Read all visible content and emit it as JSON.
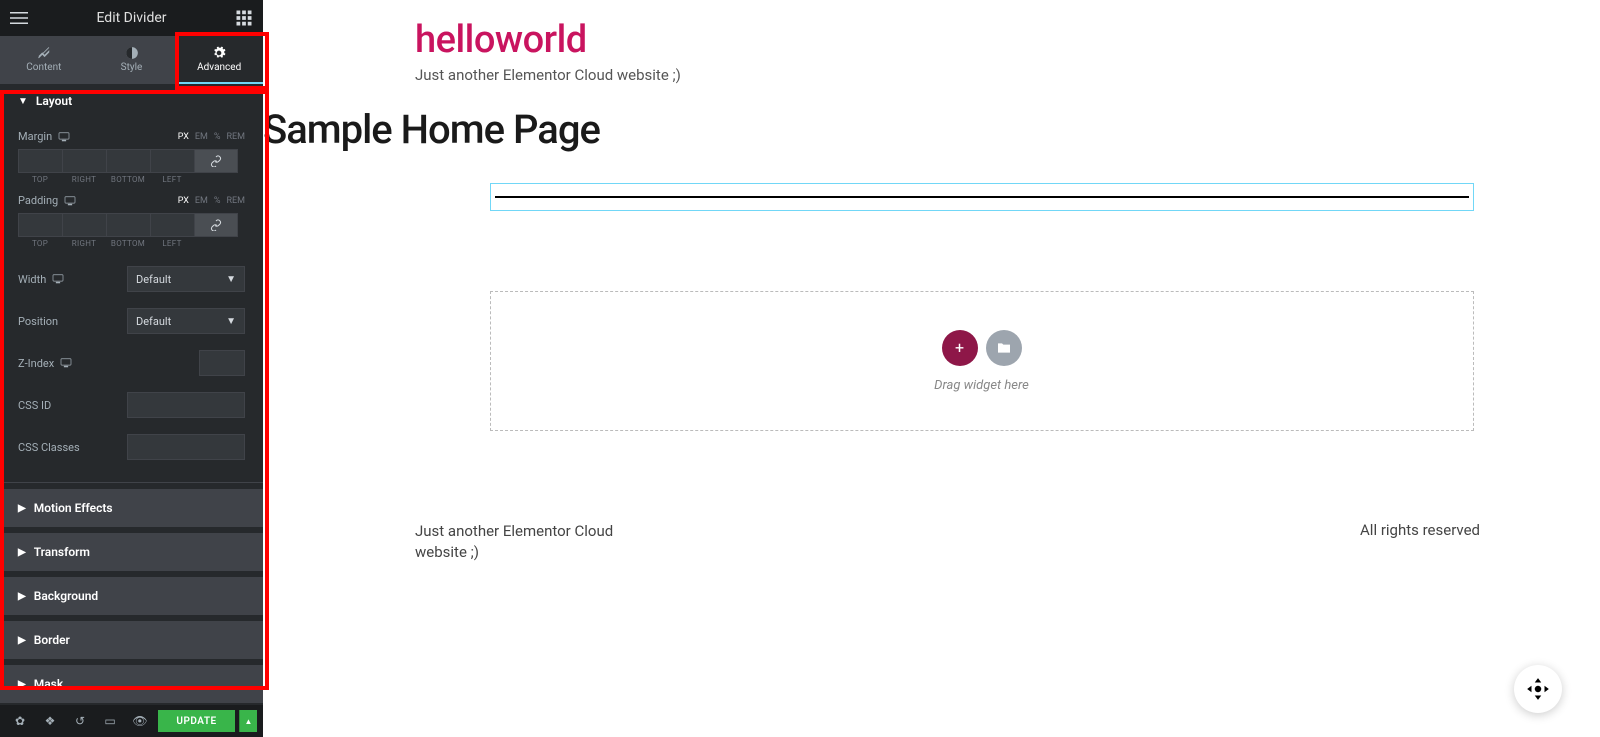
{
  "header": {
    "title": "Edit Divider"
  },
  "tabs": {
    "content": "Content",
    "style": "Style",
    "advanced": "Advanced"
  },
  "sections": {
    "layout": "Layout",
    "motion": "Motion Effects",
    "transform": "Transform",
    "background": "Background",
    "border": "Border",
    "mask": "Mask"
  },
  "layout": {
    "margin_label": "Margin",
    "padding_label": "Padding",
    "units": {
      "px": "PX",
      "em": "EM",
      "pct": "%",
      "rem": "REM"
    },
    "sides": {
      "top": "TOP",
      "right": "RIGHT",
      "bottom": "BOTTOM",
      "left": "LEFT"
    },
    "width_label": "Width",
    "width_value": "Default",
    "position_label": "Position",
    "position_value": "Default",
    "zindex_label": "Z-Index",
    "cssid_label": "CSS ID",
    "cssclasses_label": "CSS Classes"
  },
  "footer_btn": "UPDATE",
  "canvas": {
    "site_title": "helloworld",
    "site_sub": "Just another Elementor Cloud website ;)",
    "page_title": "Sample Home Page",
    "drop_text": "Drag widget here",
    "footer_left": "Just another Elementor Cloud website ;)",
    "footer_right": "All rights reserved"
  }
}
